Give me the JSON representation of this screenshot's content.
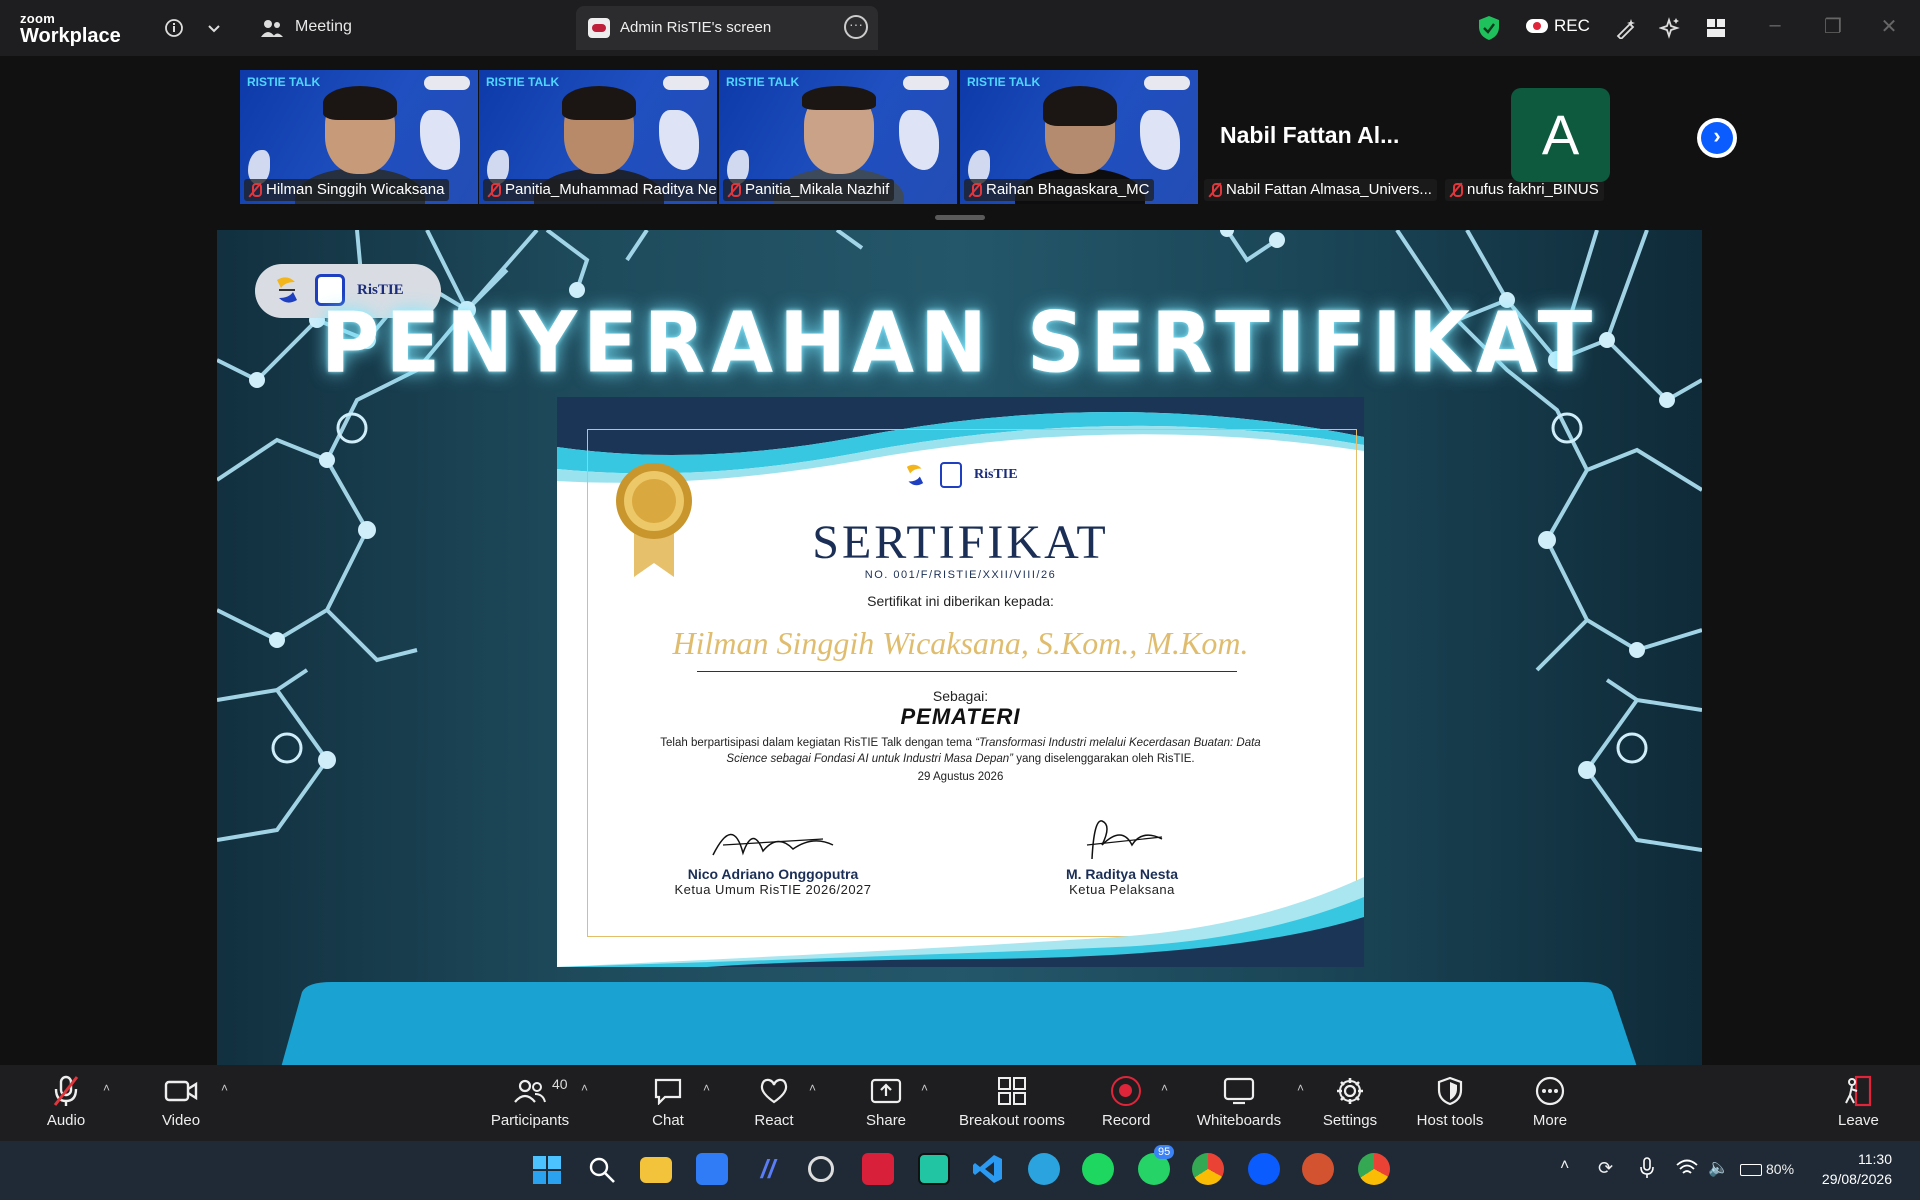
{
  "titlebar": {
    "logo_line1": "zoom",
    "logo_line2": "Workplace",
    "meeting_label": "Meeting",
    "screen_tab_label": "Admin RisTIE's screen",
    "rec_label": "REC"
  },
  "participants": [
    {
      "name": "Hilman Singgih Wicaksana",
      "muted": true,
      "brand": "RISTIE TALK"
    },
    {
      "name": "Panitia_Muhammad Raditya Ne...",
      "muted": true,
      "brand": "RISTIE TALK",
      "active_speaker": true
    },
    {
      "name": "Panitia_Mikala Nazhif",
      "muted": true,
      "brand": "RISTIE TALK"
    },
    {
      "name": "Raihan Bhagaskara_MC",
      "muted": true,
      "brand": "RISTIE TALK"
    },
    {
      "name": "Nabil Fattan Almasa_Univers...",
      "muted": true,
      "display_text": "Nabil  Fattan  Al..."
    },
    {
      "name": "nufus fakhri_BINUS",
      "muted": true,
      "avatar_letter": "A",
      "avatar_color": "#0e5a3f"
    }
  ],
  "slide": {
    "title": "PENYERAHAN SERTIFIKAT",
    "logo_text": "RisTIE",
    "certificate": {
      "heading": "SERTIFIKAT",
      "number": "NO. 001/F/RISTIE/XXII/VIII/26",
      "given_to_label": "Sertifikat ini diberikan kepada:",
      "recipient": "Hilman Singgih Wicaksana, S.Kom., M.Kom.",
      "as_label": "Sebagai:",
      "role": "PEMATERI",
      "description_plain": "Telah berpartisipasi dalam kegiatan RisTIE Talk dengan tema ",
      "description_theme": "“Transformasi Industri melalui Kecerdasan Buatan: Data Science sebagai Fondasi AI untuk Industri Masa Depan”",
      "description_tail": " yang diselenggarakan oleh RisTIE.",
      "date": "29 Agustus 2026",
      "signatories": [
        {
          "name": "Nico Adriano Onggoputra",
          "title": "Ketua Umum RisTIE 2026/2027"
        },
        {
          "name": "M. Raditya Nesta",
          "title": "Ketua Pelaksana"
        }
      ]
    }
  },
  "toolbar": {
    "audio": "Audio",
    "video": "Video",
    "participants": "Participants",
    "participants_count": "40",
    "chat": "Chat",
    "react": "React",
    "share": "Share",
    "breakout": "Breakout rooms",
    "record": "Record",
    "whiteboards": "Whiteboards",
    "settings": "Settings",
    "host_tools": "Host tools",
    "more": "More",
    "leave": "Leave"
  },
  "taskbar": {
    "whatsapp_badge": "95",
    "battery": "80%",
    "time": "11:30",
    "date": "29/08/2026"
  },
  "colors": {
    "accent_blue": "#0b5cff",
    "active_speaker": "#28c75a",
    "record_red": "#e0243a",
    "leave_red": "#e0243a",
    "gold": "#e0bd6e",
    "navy": "#1b2f56"
  }
}
